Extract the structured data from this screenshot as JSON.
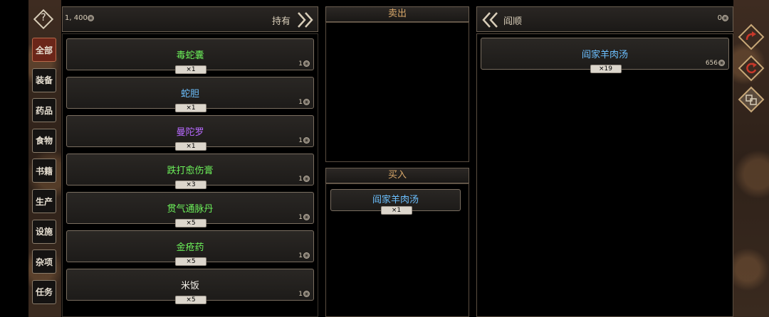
{
  "topbar": {
    "money": "1, 400",
    "held_label": "持有",
    "help_glyph": "?"
  },
  "categories": [
    {
      "label": "全部",
      "active": true
    },
    {
      "label": "装备"
    },
    {
      "label": "药品"
    },
    {
      "label": "食物"
    },
    {
      "label": "书籍"
    },
    {
      "label": "生产"
    },
    {
      "label": "设施"
    },
    {
      "label": "杂项"
    },
    {
      "label": "任务"
    }
  ],
  "inventory": [
    {
      "name": "毒蛇囊",
      "qty": "×1",
      "price": "1",
      "color": "#6cf05a"
    },
    {
      "name": "蛇胆",
      "qty": "×1",
      "price": "1",
      "color": "#6cc0ff"
    },
    {
      "name": "曼陀罗",
      "qty": "×1",
      "price": "1",
      "color": "#b86aff"
    },
    {
      "name": "跌打愈伤膏",
      "qty": "×3",
      "price": "1",
      "color": "#6cf05a"
    },
    {
      "name": "贯气通脉丹",
      "qty": "×5",
      "price": "1",
      "color": "#6cf05a"
    },
    {
      "name": "金疮药",
      "qty": "×5",
      "price": "1",
      "color": "#6cf05a"
    },
    {
      "name": "米饭",
      "qty": "×5",
      "price": "1",
      "color": "#f2efe8"
    }
  ],
  "sell": {
    "header": "卖出"
  },
  "buy": {
    "header": "买入",
    "items": [
      {
        "name": "阎家羊肉汤",
        "qty": "×1",
        "color": "#6cc0ff"
      }
    ]
  },
  "merchant": {
    "name": "阎顺",
    "money": "0",
    "items": [
      {
        "name": "阎家羊肉汤",
        "qty": "×19",
        "price": "656",
        "color": "#6cc0ff"
      }
    ]
  },
  "side_buttons": [
    "confirm-trade-icon",
    "reset-icon",
    "swap-icon"
  ]
}
